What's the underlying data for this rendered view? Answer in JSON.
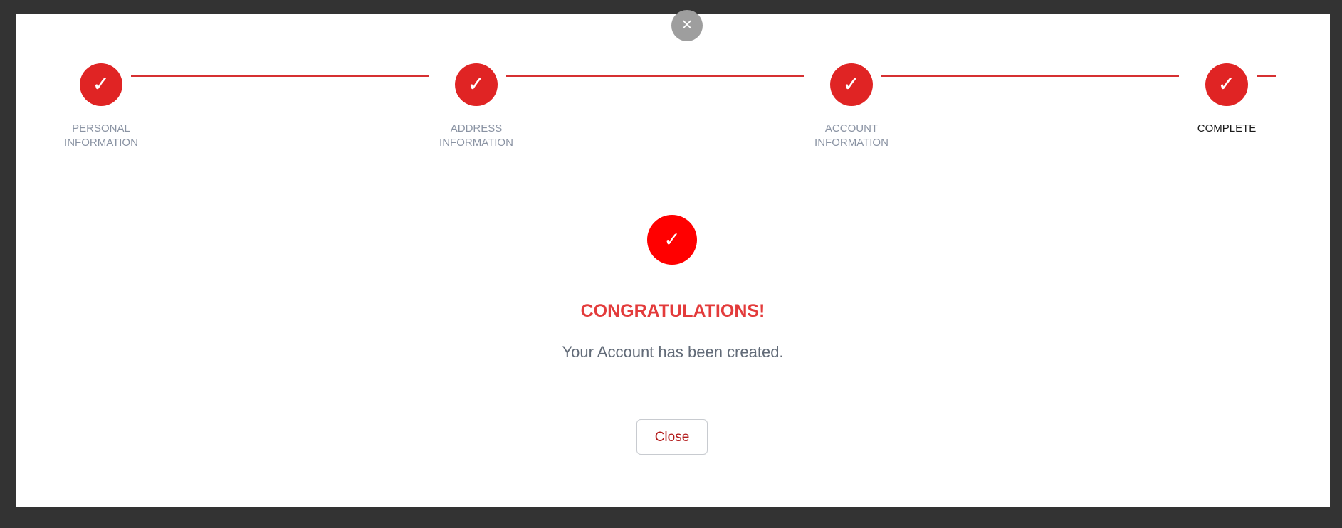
{
  "modal": {
    "close_icon": "×"
  },
  "steps": [
    {
      "label": "Personal\nInformation",
      "icon": "✓"
    },
    {
      "label": "Address\nInformation",
      "icon": "✓"
    },
    {
      "label": "Account\nInformation",
      "icon": "✓"
    },
    {
      "label": "Complete",
      "icon": "✓"
    }
  ],
  "success": {
    "icon": "✓",
    "title": "CONGRATULATIONS!",
    "message": "Your Account has been created."
  },
  "actions": {
    "close_label": "Close"
  },
  "colors": {
    "accent": "#e02424",
    "success_icon": "#ff0000",
    "title": "#e33b3b"
  }
}
